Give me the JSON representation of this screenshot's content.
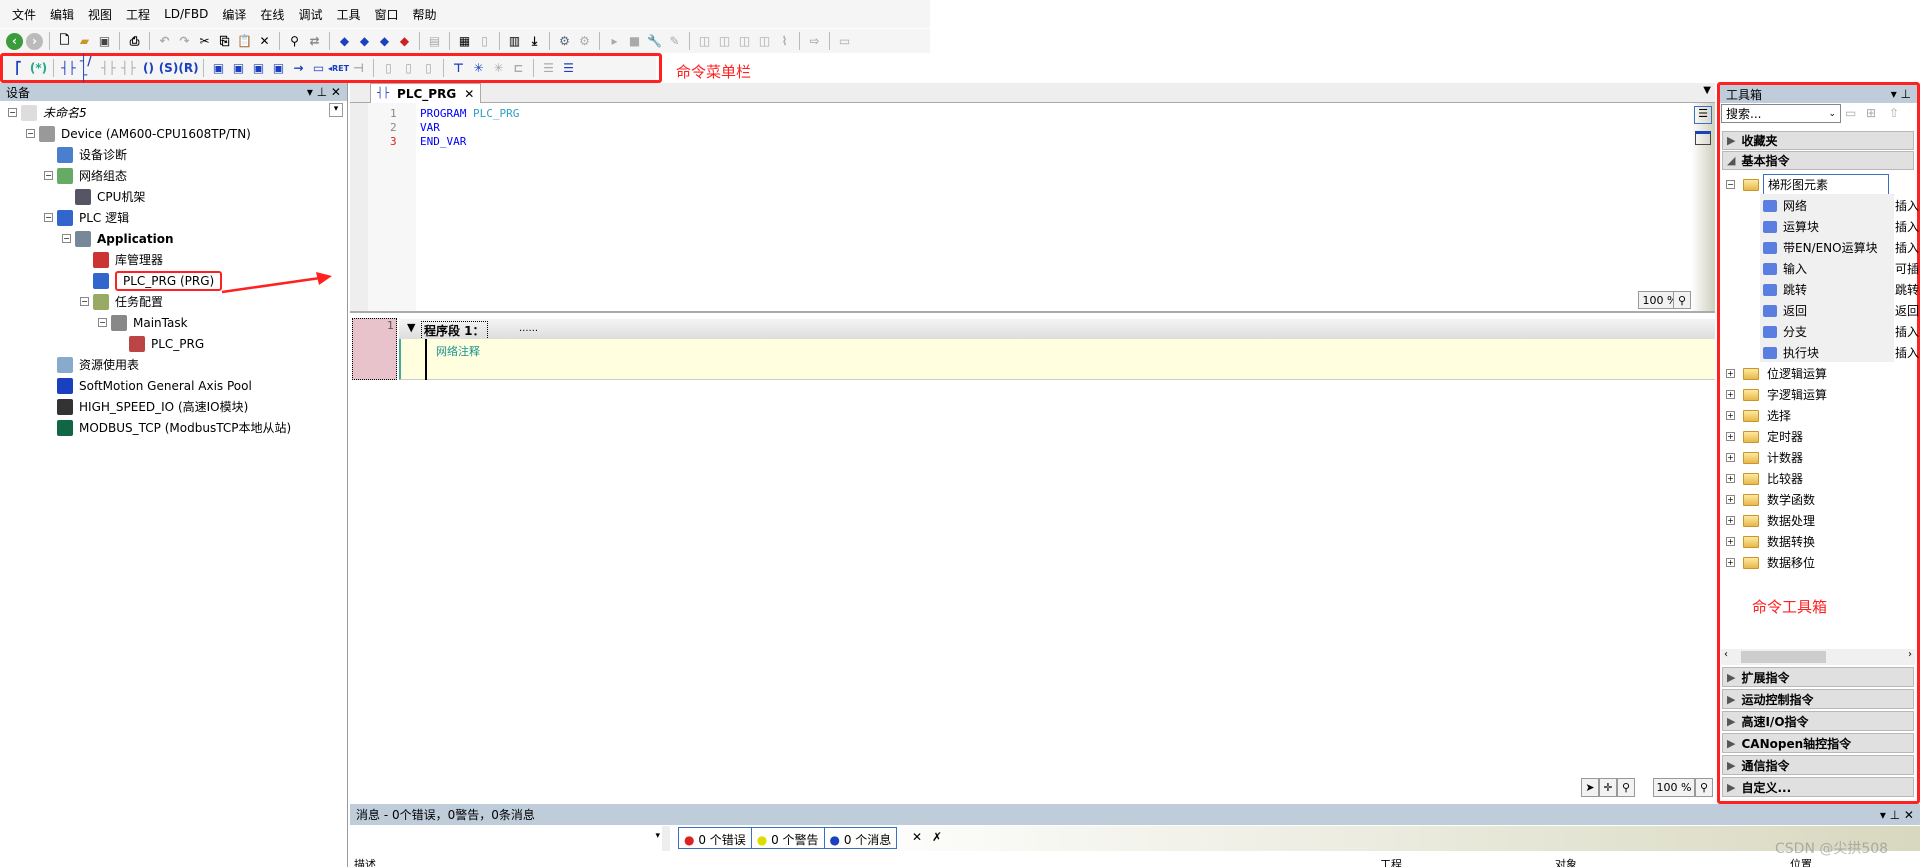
{
  "menu": [
    "文件",
    "编辑",
    "视图",
    "工程",
    "LD/FBD",
    "编译",
    "在线",
    "调试",
    "工具",
    "窗口",
    "帮助"
  ],
  "annotations": {
    "toolbar_label": "命令菜单栏",
    "toolbox_label": "命令工具箱"
  },
  "colors": {
    "annotation_red": "#ff2020",
    "panel_header": "#bfcddb",
    "network_bg": "#ffffe0",
    "keyword": "#0000ff",
    "identifier": "#2f9fc9"
  },
  "devices_panel": {
    "title": "设备",
    "tree": [
      {
        "label": "未命名5",
        "level": 0,
        "icon": "project-icon",
        "italic": true,
        "expander": "-"
      },
      {
        "label": "Device (AM600-CPU1608TP/TN)",
        "level": 1,
        "icon": "device-icon",
        "expander": "-"
      },
      {
        "label": "设备诊断",
        "level": 2,
        "icon": "diagnostics-icon"
      },
      {
        "label": "网络组态",
        "level": 2,
        "icon": "network-config-icon",
        "expander": "-"
      },
      {
        "label": "CPU机架",
        "level": 3,
        "icon": "cpu-rack-icon"
      },
      {
        "label": "PLC 逻辑",
        "level": 2,
        "icon": "plc-logic-icon",
        "expander": "-"
      },
      {
        "label": "Application",
        "level": 3,
        "icon": "gear-icon",
        "bold": true,
        "expander": "-"
      },
      {
        "label": "库管理器",
        "level": 4,
        "icon": "library-icon"
      },
      {
        "label": "PLC_PRG (PRG)",
        "level": 4,
        "icon": "ladder-pou-icon",
        "highlighted": true
      },
      {
        "label": "任务配置",
        "level": 4,
        "icon": "task-config-icon",
        "expander": "-"
      },
      {
        "label": "MainTask",
        "level": 5,
        "icon": "task-icon",
        "expander": "-"
      },
      {
        "label": "PLC_PRG",
        "level": 6,
        "icon": "program-call-icon"
      },
      {
        "label": "资源使用表",
        "level": 2,
        "icon": "table-icon"
      },
      {
        "label": "SoftMotion General Axis Pool",
        "level": 2,
        "icon": "axis-icon"
      },
      {
        "label": "HIGH_SPEED_IO (高速IO模块)",
        "level": 2,
        "icon": "io-module-icon"
      },
      {
        "label": "MODBUS_TCP (ModbusTCP本地从站)",
        "level": 2,
        "icon": "modbus-icon"
      }
    ]
  },
  "editor": {
    "tab": "PLC_PRG",
    "declaration": [
      {
        "num": "1",
        "tokens": [
          {
            "t": "PROGRAM ",
            "c": "kw"
          },
          {
            "t": "PLC_PRG",
            "c": "id"
          }
        ]
      },
      {
        "num": "2",
        "tokens": [
          {
            "t": "VAR",
            "c": "kw"
          }
        ]
      },
      {
        "num": "3",
        "tokens": [
          {
            "t": "END_VAR",
            "c": "kw"
          }
        ],
        "num_red": true
      }
    ],
    "zoom_top": "100 %",
    "network": {
      "number": "1",
      "title": "程序段 1：",
      "dots": "......",
      "comment": "网络注释"
    },
    "zoom_bottom": "100 %"
  },
  "toolbox": {
    "title": "工具箱",
    "search_placeholder": "搜索...",
    "sections_top": [
      {
        "label": "收藏夹",
        "expanded": false
      },
      {
        "label": "基本指令",
        "expanded": true
      }
    ],
    "group": "梯形图元素",
    "items": [
      {
        "label": "网络",
        "desc": "插入"
      },
      {
        "label": "运算块",
        "desc": "插入"
      },
      {
        "label": "带EN/ENO运算块",
        "desc": "插入"
      },
      {
        "label": "输入",
        "desc": "可插"
      },
      {
        "label": "跳转",
        "desc": "跳转"
      },
      {
        "label": "返回",
        "desc": "返回"
      },
      {
        "label": "分支",
        "desc": "插入"
      },
      {
        "label": "执行块",
        "desc": "插入"
      }
    ],
    "folders": [
      "位逻辑运算",
      "字逻辑运算",
      "选择",
      "定时器",
      "计数器",
      "比较器",
      "数学函数",
      "数据处理",
      "数据转换",
      "数据移位"
    ],
    "sections_bottom": [
      "扩展指令",
      "运动控制指令",
      "高速I/O指令",
      "CANopen轴控指令",
      "通信指令",
      "自定义..."
    ]
  },
  "messages": {
    "title": "消息 - 0个错误，0警告，0条消息",
    "errors": "0 个错误",
    "warnings": "0 个警告",
    "infos": "0 个消息",
    "columns": [
      "描述",
      "工程",
      "对象",
      "位置"
    ]
  },
  "watermark": "CSDN @尖拱508"
}
